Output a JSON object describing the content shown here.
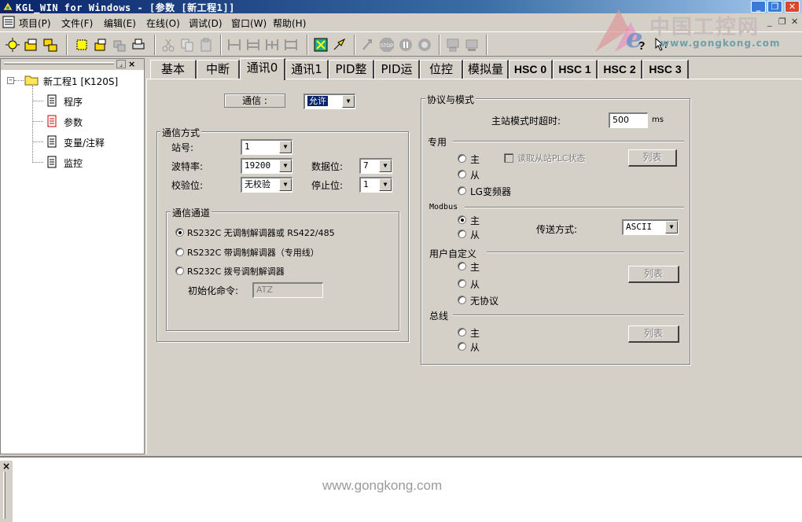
{
  "window": {
    "title": "KGL_WIN for Windows - [参数 [新工程1]]",
    "minimize": "_",
    "maximize": "❐",
    "close": "✕"
  },
  "menu": {
    "items": [
      "项目(P)",
      "文件(F)",
      "编辑(E)",
      "在线(O)",
      "调试(D)",
      "窗口(W)",
      "帮助(H)"
    ],
    "mdi_min": "_",
    "mdi_restore": "❐",
    "mdi_close": "✕"
  },
  "logo": {
    "cn": "中国工控网",
    "url": "www.gongkong.com"
  },
  "tree": {
    "root": "新工程1 [K120S]",
    "children": [
      "程序",
      "参数",
      "变量/注释",
      "监控"
    ]
  },
  "tabs": [
    "基本",
    "中断",
    "通讯0",
    "通讯1",
    "PID整定",
    "PID运算",
    "位控",
    "模拟量",
    "HSC 0",
    "HSC 1",
    "HSC 2",
    "HSC 3"
  ],
  "active_tab": "通讯0",
  "comm": {
    "enable_label": "通信 :",
    "enable_value": "允许",
    "method": {
      "title": "通信方式",
      "station_label": "站号:",
      "station_value": "1",
      "baud_label": "波特率:",
      "baud_value": "19200",
      "databits_label": "数据位:",
      "databits_value": "7",
      "parity_label": "校验位:",
      "parity_value": "无校验",
      "stopbits_label": "停止位:",
      "stopbits_value": "1"
    },
    "channel": {
      "title": "通信通道",
      "options": [
        "RS232C 无调制解调器或 RS422/485",
        "RS232C 带调制解调器（专用线）",
        "RS232C 拨号调制解调器"
      ],
      "selected": 0,
      "init_label": "初始化命令:",
      "init_value": "ATZ"
    }
  },
  "protocol": {
    "title": "协议与模式",
    "timeout_label": "主站模式时超时:",
    "timeout_value": "500",
    "timeout_unit": "ms",
    "dedicated": {
      "title": "专用",
      "master": "主",
      "slave": "从",
      "lg_inverter": "LG变频器",
      "read_slave_label": "读取从站PLC状态",
      "list_button": "列表"
    },
    "modbus": {
      "title": "Modbus",
      "master": "主",
      "slave": "从",
      "transmit_label": "传送方式:",
      "transmit_value": "ASCII",
      "selected": "master"
    },
    "user_defined": {
      "title": "用户自定义",
      "master": "主",
      "slave": "从",
      "no_protocol": "无协议",
      "list_button": "列表"
    },
    "bus": {
      "title": "总线",
      "master": "主",
      "slave": "从",
      "list_button": "列表"
    }
  },
  "output": {
    "close": "×",
    "watermark": "www.gongkong.com"
  }
}
